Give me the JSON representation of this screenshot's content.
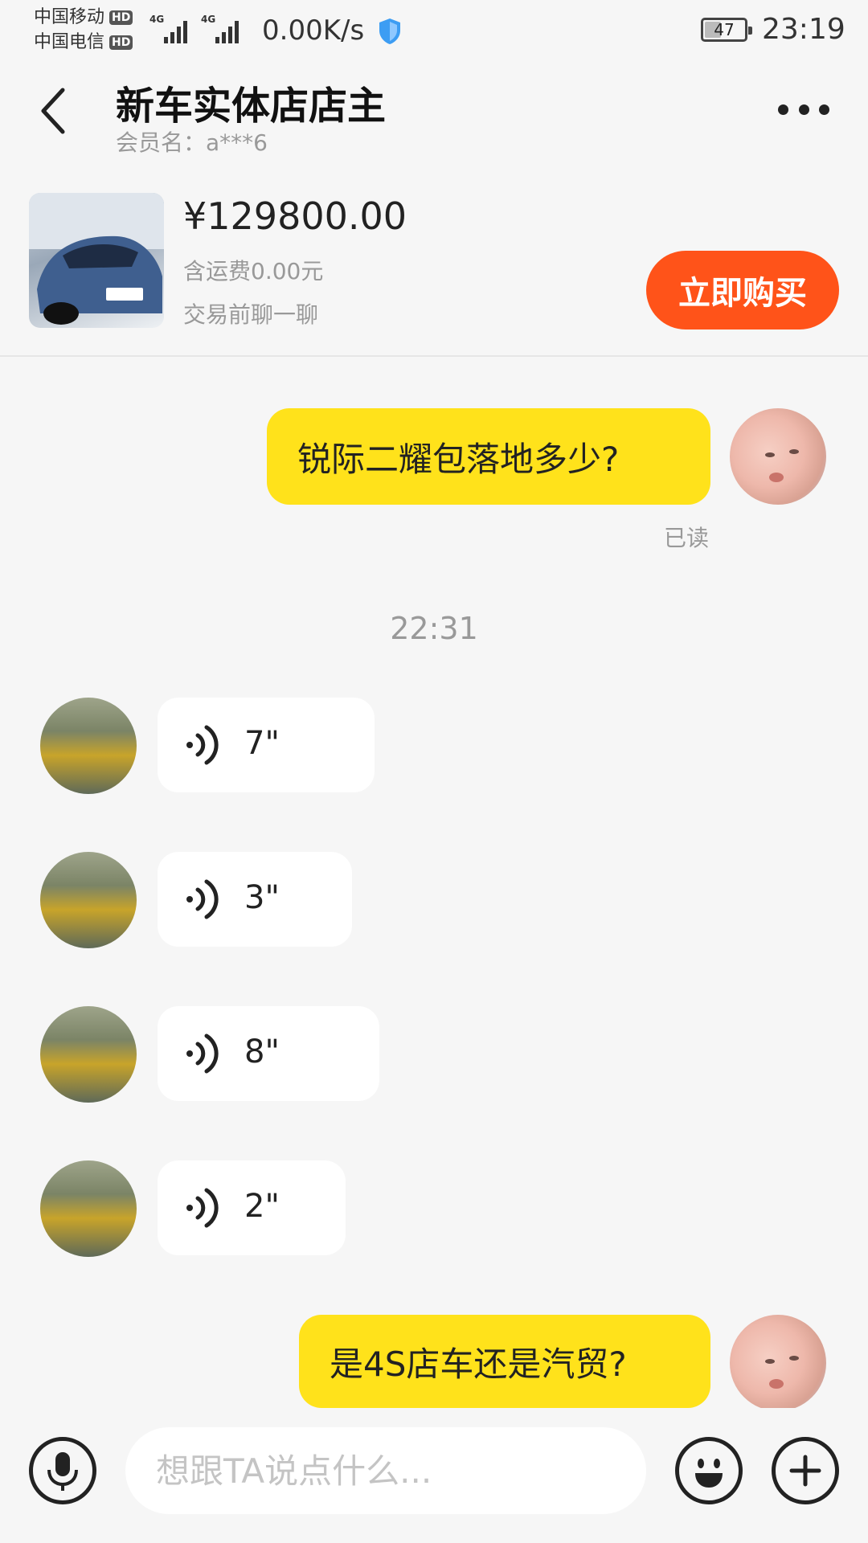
{
  "status_bar": {
    "carrier_1": "中国移动",
    "carrier_2": "中国电信",
    "hd_label": "HD",
    "net_label": "4G",
    "net_speed": "0.00K/s",
    "battery": "47",
    "time": "23:19"
  },
  "header": {
    "title": "新车实体店店主",
    "member_label": "会员名：a***6"
  },
  "product": {
    "price": "¥129800.00",
    "shipping": "含运费0.00元",
    "hint": "交易前聊一聊",
    "buy_label": "立即购买"
  },
  "messages": {
    "m1_text": "锐际二耀包落地多少?",
    "m1_status": "已读",
    "timestamp": "22:31",
    "voice": [
      {
        "duration": "7\""
      },
      {
        "duration": "3\""
      },
      {
        "duration": "8\""
      },
      {
        "duration": "2\""
      }
    ],
    "m2_text": "是4S店车还是汽贸?"
  },
  "input": {
    "placeholder": "想跟TA说点什么..."
  },
  "colors": {
    "accent_yellow": "#ffe21b",
    "buy_orange": "#ff5319"
  }
}
